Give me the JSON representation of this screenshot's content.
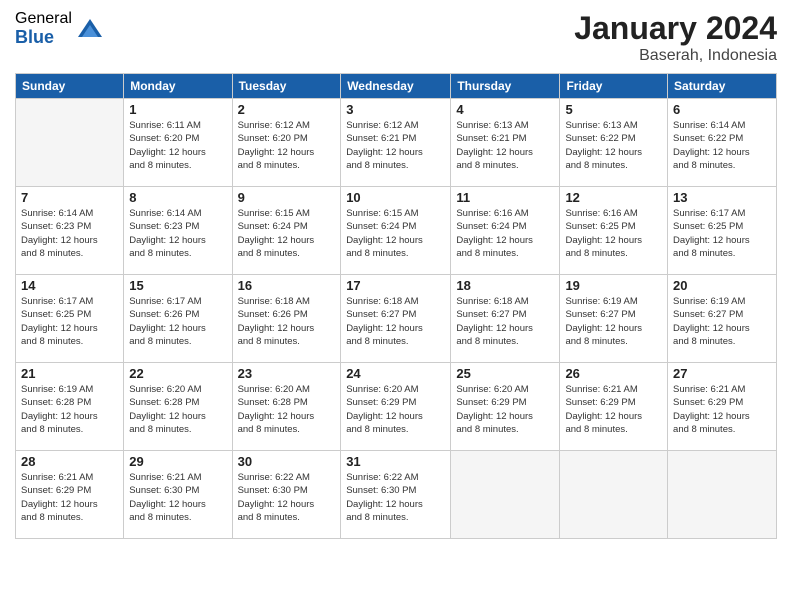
{
  "logo": {
    "general": "General",
    "blue": "Blue"
  },
  "title": "January 2024",
  "location": "Baserah, Indonesia",
  "days_of_week": [
    "Sunday",
    "Monday",
    "Tuesday",
    "Wednesday",
    "Thursday",
    "Friday",
    "Saturday"
  ],
  "weeks": [
    [
      {
        "day": "",
        "info": ""
      },
      {
        "day": "1",
        "info": "Sunrise: 6:11 AM\nSunset: 6:20 PM\nDaylight: 12 hours\nand 8 minutes."
      },
      {
        "day": "2",
        "info": "Sunrise: 6:12 AM\nSunset: 6:20 PM\nDaylight: 12 hours\nand 8 minutes."
      },
      {
        "day": "3",
        "info": "Sunrise: 6:12 AM\nSunset: 6:21 PM\nDaylight: 12 hours\nand 8 minutes."
      },
      {
        "day": "4",
        "info": "Sunrise: 6:13 AM\nSunset: 6:21 PM\nDaylight: 12 hours\nand 8 minutes."
      },
      {
        "day": "5",
        "info": "Sunrise: 6:13 AM\nSunset: 6:22 PM\nDaylight: 12 hours\nand 8 minutes."
      },
      {
        "day": "6",
        "info": "Sunrise: 6:14 AM\nSunset: 6:22 PM\nDaylight: 12 hours\nand 8 minutes."
      }
    ],
    [
      {
        "day": "7",
        "info": "Sunrise: 6:14 AM\nSunset: 6:23 PM\nDaylight: 12 hours\nand 8 minutes."
      },
      {
        "day": "8",
        "info": "Sunrise: 6:14 AM\nSunset: 6:23 PM\nDaylight: 12 hours\nand 8 minutes."
      },
      {
        "day": "9",
        "info": "Sunrise: 6:15 AM\nSunset: 6:24 PM\nDaylight: 12 hours\nand 8 minutes."
      },
      {
        "day": "10",
        "info": "Sunrise: 6:15 AM\nSunset: 6:24 PM\nDaylight: 12 hours\nand 8 minutes."
      },
      {
        "day": "11",
        "info": "Sunrise: 6:16 AM\nSunset: 6:24 PM\nDaylight: 12 hours\nand 8 minutes."
      },
      {
        "day": "12",
        "info": "Sunrise: 6:16 AM\nSunset: 6:25 PM\nDaylight: 12 hours\nand 8 minutes."
      },
      {
        "day": "13",
        "info": "Sunrise: 6:17 AM\nSunset: 6:25 PM\nDaylight: 12 hours\nand 8 minutes."
      }
    ],
    [
      {
        "day": "14",
        "info": "Sunrise: 6:17 AM\nSunset: 6:25 PM\nDaylight: 12 hours\nand 8 minutes."
      },
      {
        "day": "15",
        "info": "Sunrise: 6:17 AM\nSunset: 6:26 PM\nDaylight: 12 hours\nand 8 minutes."
      },
      {
        "day": "16",
        "info": "Sunrise: 6:18 AM\nSunset: 6:26 PM\nDaylight: 12 hours\nand 8 minutes."
      },
      {
        "day": "17",
        "info": "Sunrise: 6:18 AM\nSunset: 6:27 PM\nDaylight: 12 hours\nand 8 minutes."
      },
      {
        "day": "18",
        "info": "Sunrise: 6:18 AM\nSunset: 6:27 PM\nDaylight: 12 hours\nand 8 minutes."
      },
      {
        "day": "19",
        "info": "Sunrise: 6:19 AM\nSunset: 6:27 PM\nDaylight: 12 hours\nand 8 minutes."
      },
      {
        "day": "20",
        "info": "Sunrise: 6:19 AM\nSunset: 6:27 PM\nDaylight: 12 hours\nand 8 minutes."
      }
    ],
    [
      {
        "day": "21",
        "info": "Sunrise: 6:19 AM\nSunset: 6:28 PM\nDaylight: 12 hours\nand 8 minutes."
      },
      {
        "day": "22",
        "info": "Sunrise: 6:20 AM\nSunset: 6:28 PM\nDaylight: 12 hours\nand 8 minutes."
      },
      {
        "day": "23",
        "info": "Sunrise: 6:20 AM\nSunset: 6:28 PM\nDaylight: 12 hours\nand 8 minutes."
      },
      {
        "day": "24",
        "info": "Sunrise: 6:20 AM\nSunset: 6:29 PM\nDaylight: 12 hours\nand 8 minutes."
      },
      {
        "day": "25",
        "info": "Sunrise: 6:20 AM\nSunset: 6:29 PM\nDaylight: 12 hours\nand 8 minutes."
      },
      {
        "day": "26",
        "info": "Sunrise: 6:21 AM\nSunset: 6:29 PM\nDaylight: 12 hours\nand 8 minutes."
      },
      {
        "day": "27",
        "info": "Sunrise: 6:21 AM\nSunset: 6:29 PM\nDaylight: 12 hours\nand 8 minutes."
      }
    ],
    [
      {
        "day": "28",
        "info": "Sunrise: 6:21 AM\nSunset: 6:29 PM\nDaylight: 12 hours\nand 8 minutes."
      },
      {
        "day": "29",
        "info": "Sunrise: 6:21 AM\nSunset: 6:30 PM\nDaylight: 12 hours\nand 8 minutes."
      },
      {
        "day": "30",
        "info": "Sunrise: 6:22 AM\nSunset: 6:30 PM\nDaylight: 12 hours\nand 8 minutes."
      },
      {
        "day": "31",
        "info": "Sunrise: 6:22 AM\nSunset: 6:30 PM\nDaylight: 12 hours\nand 8 minutes."
      },
      {
        "day": "",
        "info": ""
      },
      {
        "day": "",
        "info": ""
      },
      {
        "day": "",
        "info": ""
      }
    ]
  ]
}
